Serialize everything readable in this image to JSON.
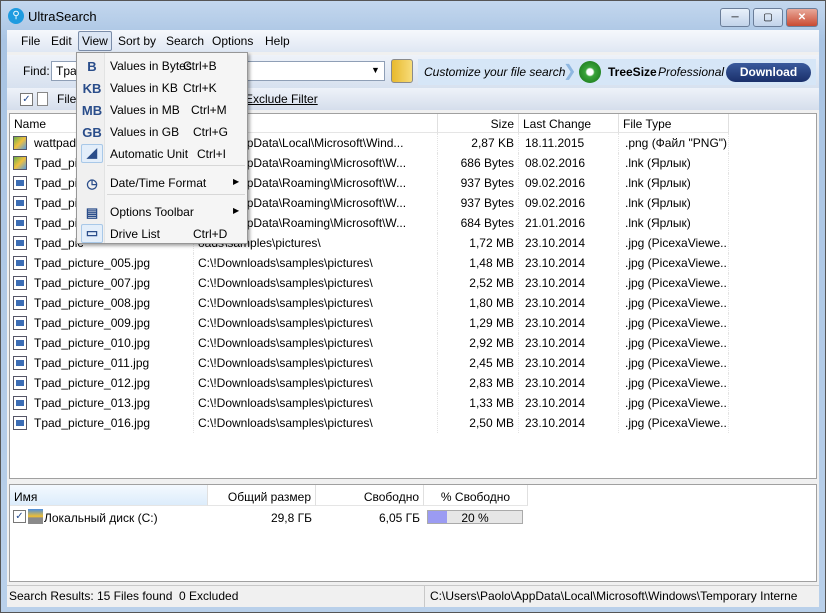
{
  "window": {
    "title": "UltraSearch",
    "controls": [
      "minimize",
      "maximize",
      "close"
    ]
  },
  "menubar": [
    "File",
    "Edit",
    "View",
    "Sort by",
    "Search",
    "Options",
    "Help"
  ],
  "find": {
    "label": "Find:",
    "value": "Tpad"
  },
  "ad": {
    "text": "Customize your file search",
    "product": "TreeSize",
    "product_em": "Professional",
    "download": "Download"
  },
  "filter": {
    "files_label": "Files",
    "exclude_filter": "Exclude Filter",
    "files_checked": true
  },
  "columns": [
    "Name",
    "",
    "Size",
    "Last Change",
    "File Type"
  ],
  "rows": [
    {
      "name": "wattpad-",
      "path": "Paolo\\AppData\\Local\\Microsoft\\Wind...",
      "size": "2,87 KB",
      "date": "18.11.2015",
      "type": ".png (Файл \"PNG\")",
      "icon": "image"
    },
    {
      "name": "Tpad_pic",
      "path": "Paolo\\AppData\\Roaming\\Microsoft\\W...",
      "size": "686 Bytes",
      "date": "08.02.2016",
      "type": ".lnk (Ярлык)",
      "icon": "image"
    },
    {
      "name": "Tpad_pic",
      "path": "Paolo\\AppData\\Roaming\\Microsoft\\W...",
      "size": "937 Bytes",
      "date": "09.02.2016",
      "type": ".lnk (Ярлык)",
      "icon": "file"
    },
    {
      "name": "Tpad_pic",
      "path": "Paolo\\AppData\\Roaming\\Microsoft\\W...",
      "size": "937 Bytes",
      "date": "09.02.2016",
      "type": ".lnk (Ярлык)",
      "icon": "file"
    },
    {
      "name": "Tpad_pic",
      "path": "Paolo\\AppData\\Roaming\\Microsoft\\W...",
      "size": "684 Bytes",
      "date": "21.01.2016",
      "type": ".lnk (Ярлык)",
      "icon": "file"
    },
    {
      "name": "Tpad_pic",
      "path": "oads\\samples\\pictures\\",
      "size": "1,72 MB",
      "date": "23.10.2014",
      "type": ".jpg (PicexaViewe...",
      "icon": "file"
    },
    {
      "name": "Tpad_picture_005.jpg",
      "path": "C:\\!Downloads\\samples\\pictures\\",
      "size": "1,48 MB",
      "date": "23.10.2014",
      "type": ".jpg (PicexaViewe...",
      "icon": "file"
    },
    {
      "name": "Tpad_picture_007.jpg",
      "path": "C:\\!Downloads\\samples\\pictures\\",
      "size": "2,52 MB",
      "date": "23.10.2014",
      "type": ".jpg (PicexaViewe...",
      "icon": "file"
    },
    {
      "name": "Tpad_picture_008.jpg",
      "path": "C:\\!Downloads\\samples\\pictures\\",
      "size": "1,80 MB",
      "date": "23.10.2014",
      "type": ".jpg (PicexaViewe...",
      "icon": "file"
    },
    {
      "name": "Tpad_picture_009.jpg",
      "path": "C:\\!Downloads\\samples\\pictures\\",
      "size": "1,29 MB",
      "date": "23.10.2014",
      "type": ".jpg (PicexaViewe...",
      "icon": "file"
    },
    {
      "name": "Tpad_picture_010.jpg",
      "path": "C:\\!Downloads\\samples\\pictures\\",
      "size": "2,92 MB",
      "date": "23.10.2014",
      "type": ".jpg (PicexaViewe...",
      "icon": "file"
    },
    {
      "name": "Tpad_picture_011.jpg",
      "path": "C:\\!Downloads\\samples\\pictures\\",
      "size": "2,45 MB",
      "date": "23.10.2014",
      "type": ".jpg (PicexaViewe...",
      "icon": "file"
    },
    {
      "name": "Tpad_picture_012.jpg",
      "path": "C:\\!Downloads\\samples\\pictures\\",
      "size": "2,83 MB",
      "date": "23.10.2014",
      "type": ".jpg (PicexaViewe...",
      "icon": "file"
    },
    {
      "name": "Tpad_picture_013.jpg",
      "path": "C:\\!Downloads\\samples\\pictures\\",
      "size": "1,33 MB",
      "date": "23.10.2014",
      "type": ".jpg (PicexaViewe...",
      "icon": "file"
    },
    {
      "name": "Tpad_picture_016.jpg",
      "path": "C:\\!Downloads\\samples\\pictures\\",
      "size": "2,50 MB",
      "date": "23.10.2014",
      "type": ".jpg (PicexaViewe...",
      "icon": "file"
    }
  ],
  "view_menu": [
    {
      "icon": "B",
      "label": "Values in Bytes",
      "shortcut": "Ctrl+B"
    },
    {
      "icon": "KB",
      "label": "Values in KB",
      "shortcut": "Ctrl+K"
    },
    {
      "icon": "MB",
      "label": "Values in MB",
      "shortcut": "Ctrl+M"
    },
    {
      "icon": "GB",
      "label": "Values in GB",
      "shortcut": "Ctrl+G"
    },
    {
      "icon": "ruler",
      "label": "Automatic Unit",
      "shortcut": "Ctrl+I",
      "checked": true
    },
    {
      "icon": "clock",
      "label": "Date/Time Format",
      "submenu": true
    },
    {
      "icon": "toolbar",
      "label": "Options Toolbar",
      "submenu": true
    },
    {
      "icon": "drive",
      "label": "Drive List",
      "shortcut": "Ctrl+D",
      "checked": true
    }
  ],
  "drives": {
    "columns": [
      "Имя",
      "Общий размер",
      "Свободно",
      "% Свободно"
    ],
    "rows": [
      {
        "name": "Локальный диск (C:)",
        "total": "29,8 ГБ",
        "free": "6,05 ГБ",
        "percent_free_label": "20 %",
        "percent_free": 20,
        "checked": true
      }
    ]
  },
  "status": {
    "label": "Search Results:",
    "found": "15 Files found",
    "excluded": "0 Excluded",
    "path": "C:\\Users\\Paolo\\AppData\\Local\\Microsoft\\Windows\\Temporary Interne"
  },
  "colors": {
    "accent": "#1a2f6a",
    "progress": "#9b9bf2",
    "adbar": "#d6e6f7"
  }
}
